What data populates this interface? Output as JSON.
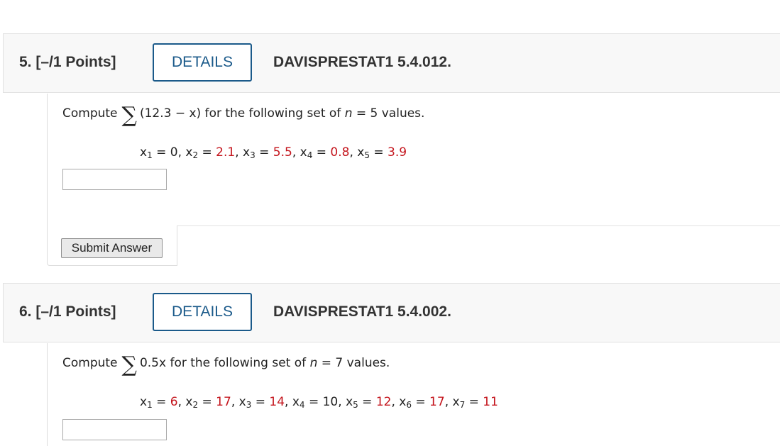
{
  "questions": [
    {
      "number_label": "5. [–/1 Points]",
      "details_label": "DETAILS",
      "code": "DAVISPRESTAT1 5.4.012.",
      "prompt": {
        "prefix": "Compute",
        "sigma": "∑",
        "expr": "(12.3 − x)",
        "suffix_a": " for the following set of ",
        "n_var": "n",
        "suffix_b": " = 5 values."
      },
      "values": [
        {
          "var": "x",
          "sub": "1",
          "eq": " = ",
          "value": "0",
          "sep": ", ",
          "highlight": false
        },
        {
          "var": "x",
          "sub": "2",
          "eq": " = ",
          "value": "2.1",
          "sep": ", ",
          "highlight": true
        },
        {
          "var": "x",
          "sub": "3",
          "eq": " = ",
          "value": "5.5",
          "sep": ", ",
          "highlight": true
        },
        {
          "var": "x",
          "sub": "4",
          "eq": " = ",
          "value": "0.8",
          "sep": ", ",
          "highlight": true
        },
        {
          "var": "x",
          "sub": "5",
          "eq": " = ",
          "value": "3.9",
          "sep": "",
          "highlight": true
        }
      ],
      "answer_value": "",
      "submit_label": "Submit Answer"
    },
    {
      "number_label": "6. [–/1 Points]",
      "details_label": "DETAILS",
      "code": "DAVISPRESTAT1 5.4.002.",
      "prompt": {
        "prefix": "Compute",
        "sigma": "∑",
        "expr": "0.5x",
        "suffix_a": " for the following set of ",
        "n_var": "n",
        "suffix_b": " = 7 values."
      },
      "values": [
        {
          "var": "x",
          "sub": "1",
          "eq": " = ",
          "value": "6",
          "sep": ", ",
          "highlight": true
        },
        {
          "var": "x",
          "sub": "2",
          "eq": " = ",
          "value": "17",
          "sep": ", ",
          "highlight": true
        },
        {
          "var": "x",
          "sub": "3",
          "eq": " = ",
          "value": "14",
          "sep": ", ",
          "highlight": true
        },
        {
          "var": "x",
          "sub": "4",
          "eq": " = ",
          "value": "10",
          "sep": ", ",
          "highlight": false
        },
        {
          "var": "x",
          "sub": "5",
          "eq": " = ",
          "value": "12",
          "sep": ", ",
          "highlight": true
        },
        {
          "var": "x",
          "sub": "6",
          "eq": " = ",
          "value": "17",
          "sep": ", ",
          "highlight": true
        },
        {
          "var": "x",
          "sub": "7",
          "eq": " = ",
          "value": "11",
          "sep": "",
          "highlight": true
        }
      ],
      "answer_value": ""
    }
  ],
  "colors": {
    "accent": "#1b5a8a",
    "highlight": "#c4141c"
  }
}
